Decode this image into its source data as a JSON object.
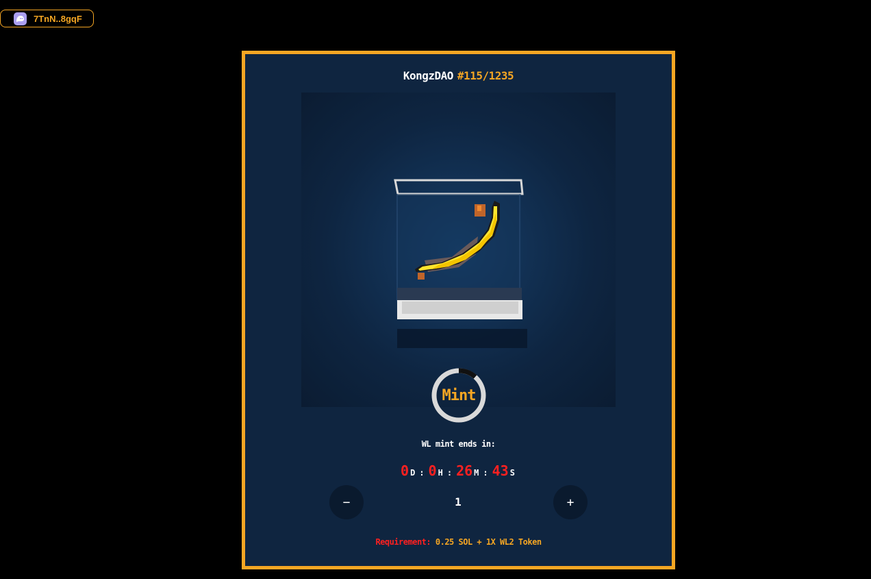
{
  "wallet": {
    "address": "7TnN..8gqF",
    "icon": "phantom-ghost-icon"
  },
  "card": {
    "collection_name": "KongzDAO",
    "count": "#115/1235",
    "art_alt": "pixel-banana-in-glass-case"
  },
  "mint": {
    "label": "Mint",
    "ends_label": "WL mint ends in:",
    "countdown": {
      "days": "0",
      "days_unit": "D",
      "hours": "0",
      "hours_unit": "H",
      "minutes": "26",
      "minutes_unit": "M",
      "seconds": "43",
      "seconds_unit": "S"
    },
    "quantity": "1",
    "minus_label": "−",
    "plus_label": "+",
    "requirement_label": "Requirement:",
    "requirement_value": "0.25 SOL + 1X WL2 Token"
  },
  "colors": {
    "accent": "#f5a623",
    "card_bg": "#0f2540",
    "countdown_red": "#ff2020"
  }
}
